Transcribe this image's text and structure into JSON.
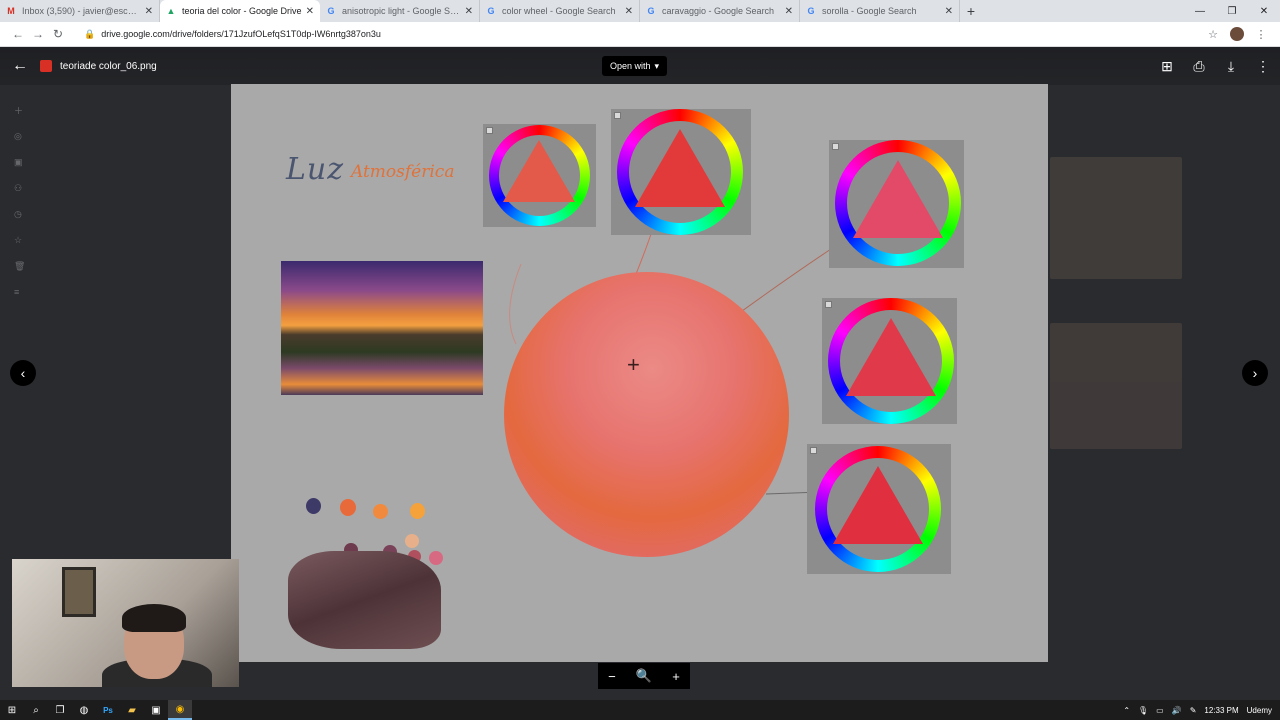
{
  "browser": {
    "tabs": [
      {
        "title": "Inbox (3,590) - javier@escuelacs",
        "favicon": "gmail-icon",
        "color": "#d93025",
        "active": false
      },
      {
        "title": "teoria del color - Google Drive",
        "favicon": "drive-icon",
        "color": "#1fa463",
        "active": true
      },
      {
        "title": "anisotropic light - Google Search",
        "favicon": "google-icon",
        "color": "#4285f4",
        "active": false
      },
      {
        "title": "color wheel - Google Search",
        "favicon": "google-icon",
        "color": "#4285f4",
        "active": false
      },
      {
        "title": "caravaggio - Google Search",
        "favicon": "google-icon",
        "color": "#4285f4",
        "active": false
      },
      {
        "title": "sorolla - Google Search",
        "favicon": "google-icon",
        "color": "#4285f4",
        "active": false
      }
    ],
    "url": "drive.google.com/drive/folders/171JzufOLefqS1T0dp-IW6nrtg387on3u"
  },
  "viewer": {
    "file_name": "teoriade color_06.png",
    "open_with": "Open with"
  },
  "canvas": {
    "handwriting_1": "Luz",
    "handwriting_2": "Atmosférica",
    "colors": {
      "sphere": "#e4693f",
      "background": "#a9a9a9"
    }
  },
  "taskbar": {
    "time": "12:33 PM",
    "brand": "Udemy"
  }
}
